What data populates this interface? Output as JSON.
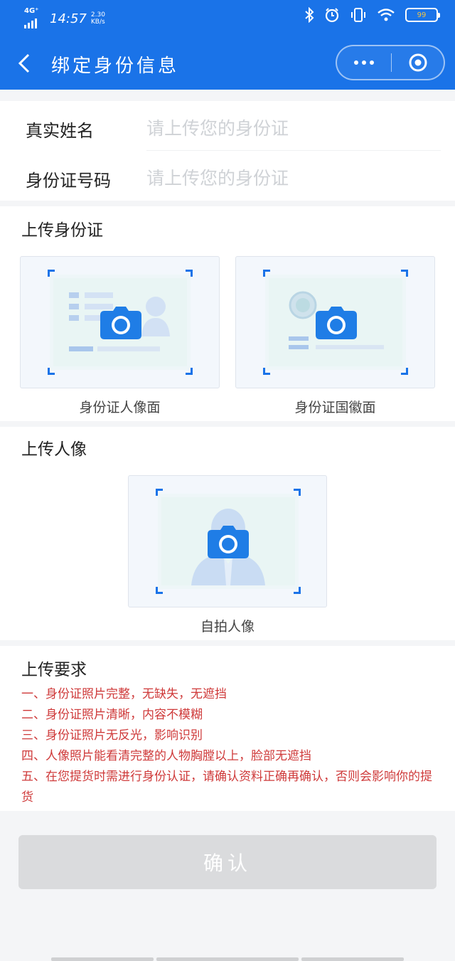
{
  "status_bar": {
    "network": "4G⁺",
    "time": "14:57",
    "speed_value": "2.30",
    "speed_unit": "KB/s",
    "battery_label": "99"
  },
  "nav": {
    "back_icon": "chevron-left-icon",
    "title": "绑定身份信息",
    "more_icon": "more-dots-icon",
    "close_icon": "target-close-icon"
  },
  "form": {
    "name_label": "真实姓名",
    "name_placeholder": "请上传您的身份证",
    "name_value": "",
    "id_label": "身份证号码",
    "id_placeholder": "请上传您的身份证",
    "id_value": ""
  },
  "id_upload": {
    "title": "上传身份证",
    "front_caption": "身份证人像面",
    "back_caption": "身份证国徽面"
  },
  "portrait_upload": {
    "title": "上传人像",
    "caption": "自拍人像"
  },
  "requirements": {
    "title": "上传要求",
    "items": [
      "一、身份证照片完整，无缺失，无遮挡",
      "二、身份证照片清晰，内容不模糊",
      "三、身份证照片无反光，影响识别",
      "四、人像照片能看清完整的人物胸膛以上，脸部无遮挡",
      "五、在您提货时需进行身份认证，请确认资料正确再确认，否则会影响你的提货"
    ]
  },
  "confirm_label": "确认",
  "colors": {
    "accent": "#1a73e8",
    "requirement_text": "#cf3a3a",
    "button_disabled": "#dadbdd"
  }
}
